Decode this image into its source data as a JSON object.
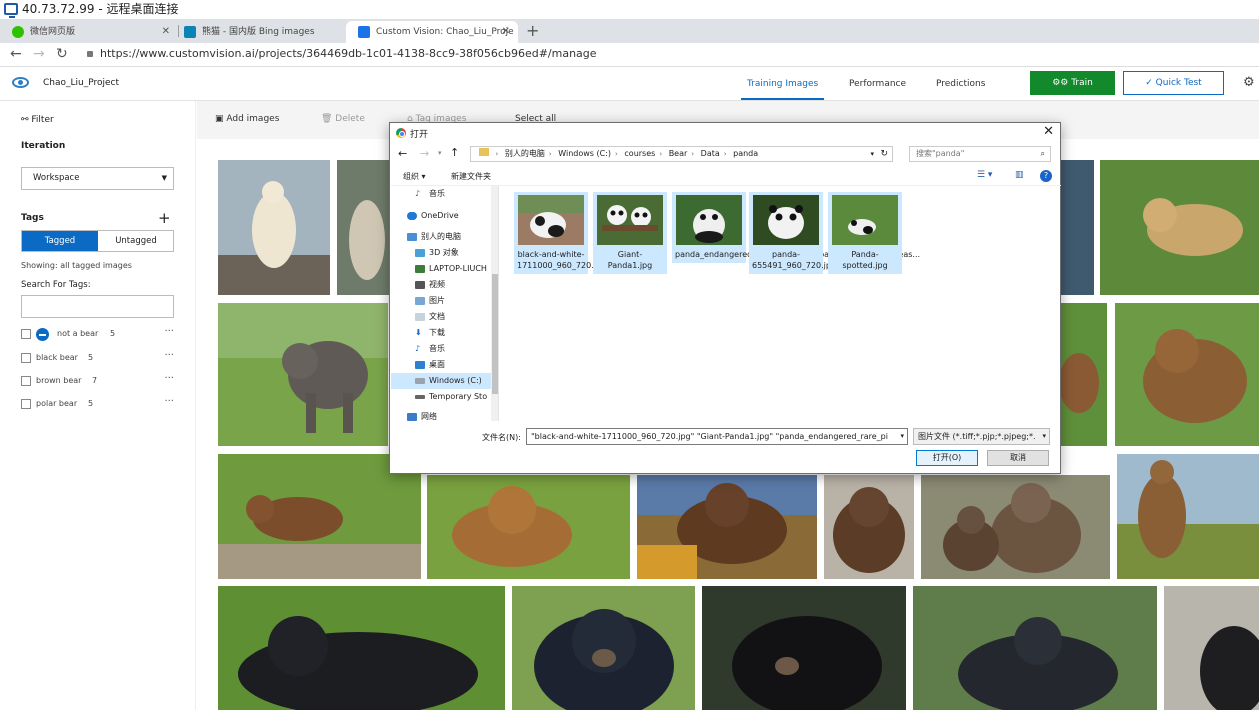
{
  "rdp": {
    "title": "40.73.72.99 - 远程桌面连接"
  },
  "browser": {
    "tabs": [
      {
        "label": "微信网页版",
        "favicon_color": "#2dc100"
      },
      {
        "label": "熊猫 - 国内版 Bing images",
        "favicon_color": "#0a84b3"
      },
      {
        "label": "Custom Vision: Chao_Liu_Proje",
        "favicon_color": "#1a73e8"
      }
    ],
    "new_tab": "+",
    "url": "https://www.customvision.ai/projects/364469db-1c01-4138-8cc9-38f056cb96ed#/manage"
  },
  "app": {
    "project_name": "Chao_Liu_Project",
    "nav_tabs": [
      "Training Images",
      "Performance",
      "Predictions"
    ],
    "train_label": "Train",
    "quick_test_label": "Quick Test",
    "accent": "#0b6ac4",
    "train_color": "#128a2b"
  },
  "sidebar": {
    "filter_label": "Filter",
    "iteration_label": "Iteration",
    "iteration_value": "Workspace",
    "tags_label": "Tags",
    "tagged_label": "Tagged",
    "untagged_label": "Untagged",
    "showing_text": "Showing: all tagged images",
    "search_tags_label": "Search For Tags:",
    "tags": [
      {
        "name": "not a bear",
        "count": "5"
      },
      {
        "name": "black bear",
        "count": "5"
      },
      {
        "name": "brown bear",
        "count": "7"
      },
      {
        "name": "polar bear",
        "count": "5"
      }
    ]
  },
  "toolbar": {
    "add_images": "Add images",
    "delete": "Delete",
    "tag_images": "Tag images",
    "select_all": "Select all"
  },
  "dialog": {
    "title": "打开",
    "path": [
      "别人的电脑",
      "Windows (C:)",
      "courses",
      "Bear",
      "Data",
      "panda"
    ],
    "search_placeholder": "搜索\"panda\"",
    "organize": "组织 ▾",
    "new_folder": "新建文件夹",
    "nav_items": [
      "音乐",
      "OneDrive",
      "别人的电脑",
      "3D 对象",
      "LAPTOP-LIUCH",
      "视频",
      "图片",
      "文档",
      "下载",
      "音乐",
      "桌面",
      "Windows (C:)",
      "Temporary Sto",
      "网络"
    ],
    "files": [
      "black-and-white-1711000_960_720.jpg",
      "Giant-Panda1.jpg",
      "panda_endangered_rare_protected_bamboo_national_treas...",
      "panda-655491_960_720.jpg",
      "Panda-spotted.jpg"
    ],
    "filename_label": "文件名(N):",
    "filename_value": "\"black-and-white-1711000_960_720.jpg\" \"Giant-Panda1.jpg\" \"panda_endangered_rare_pi",
    "filetype_value": "图片文件 (*.tiff;*.pjp;*.pjpeg;*.",
    "open_label": "打开(O)",
    "cancel_label": "取消"
  }
}
